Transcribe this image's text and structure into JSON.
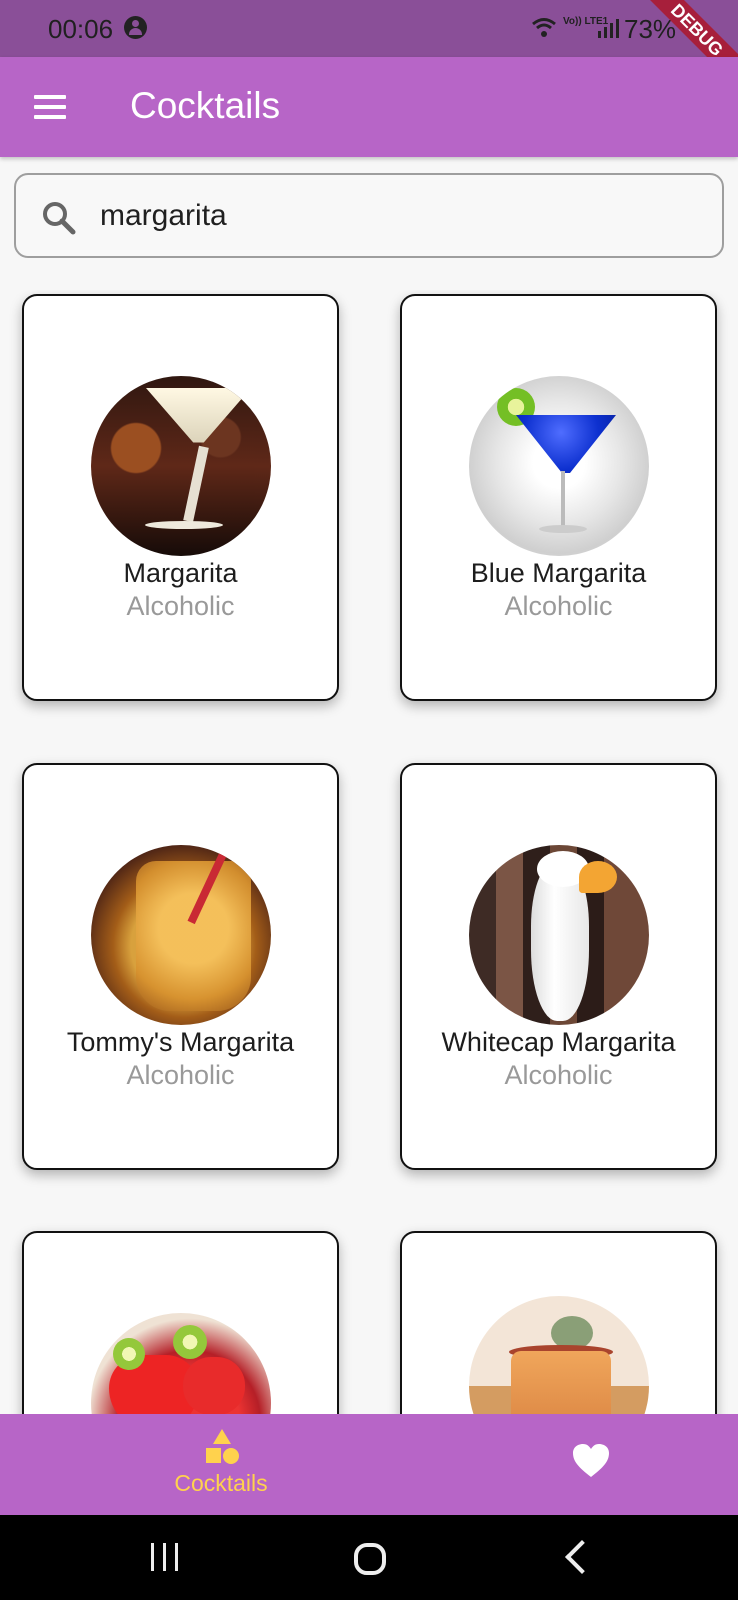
{
  "status": {
    "time": "00:06",
    "network": "Vo)) LTE1",
    "battery": "73%",
    "debug_label": "DEBUG"
  },
  "app": {
    "title": "Cocktails"
  },
  "search": {
    "value": "margarita",
    "icon": "search-icon"
  },
  "cards": [
    {
      "name": "Margarita",
      "category": "Alcoholic"
    },
    {
      "name": "Blue Margarita",
      "category": "Alcoholic"
    },
    {
      "name": "Tommy's Margarita",
      "category": "Alcoholic"
    },
    {
      "name": "Whitecap Margarita",
      "category": "Alcoholic"
    },
    {
      "name": "",
      "category": ""
    },
    {
      "name": "",
      "category": ""
    }
  ],
  "bottom_nav": {
    "cocktails_label": "Cocktails",
    "favorites_icon": "heart-icon"
  },
  "colors": {
    "status_bar": "#8a4f98",
    "app_bar": "#b765c7",
    "active_nav": "#ffd24d",
    "debug_ribbon": "#a71f3b"
  }
}
